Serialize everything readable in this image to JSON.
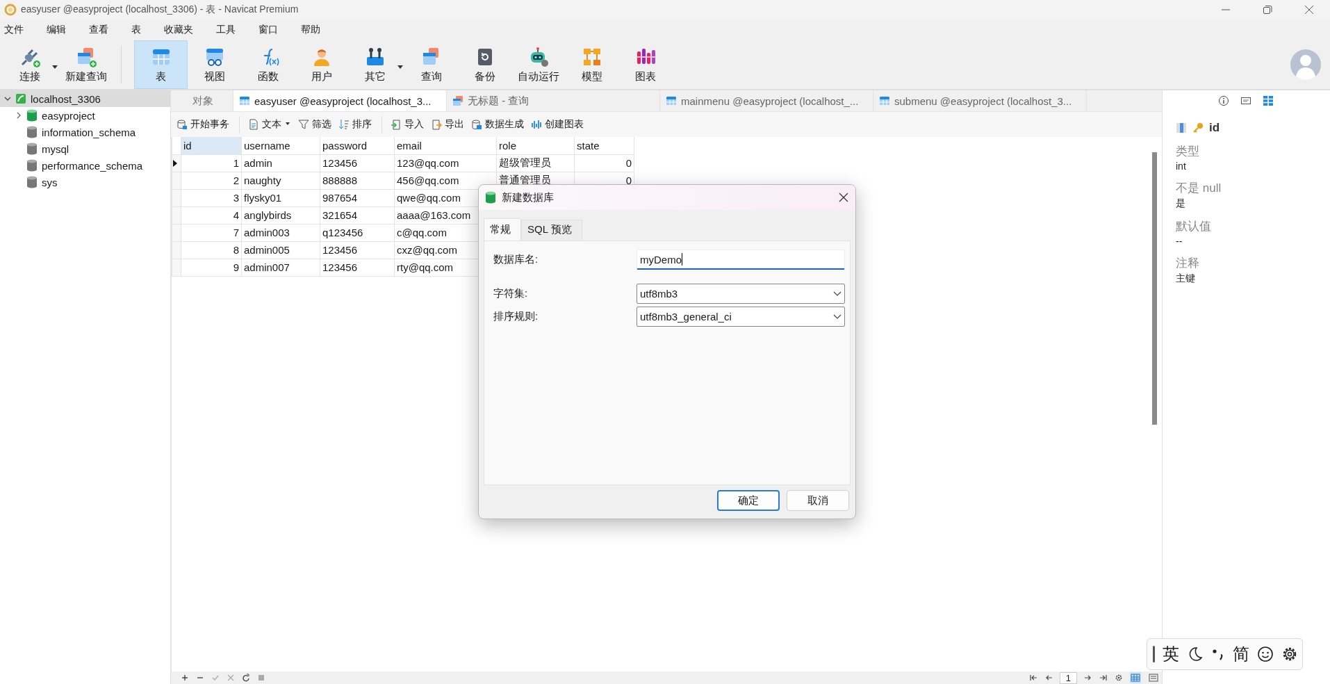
{
  "window": {
    "title": "easyuser @easyproject (localhost_3306) - 表 - Navicat Premium"
  },
  "menu": [
    "文件",
    "编辑",
    "查看",
    "表",
    "收藏夹",
    "工具",
    "窗口",
    "帮助"
  ],
  "toolbar": [
    {
      "label": "连接",
      "selected": false,
      "has_menu": true
    },
    {
      "label": "新建查询",
      "selected": false,
      "has_menu": false
    },
    {
      "label": "表",
      "selected": true,
      "has_menu": false
    },
    {
      "label": "视图",
      "selected": false,
      "has_menu": false
    },
    {
      "label": "函数",
      "selected": false,
      "has_menu": false
    },
    {
      "label": "用户",
      "selected": false,
      "has_menu": false
    },
    {
      "label": "其它",
      "selected": false,
      "has_menu": true
    },
    {
      "label": "查询",
      "selected": false,
      "has_menu": false
    },
    {
      "label": "备份",
      "selected": false,
      "has_menu": false
    },
    {
      "label": "自动运行",
      "selected": false,
      "has_menu": false
    },
    {
      "label": "模型",
      "selected": false,
      "has_menu": false
    },
    {
      "label": "图表",
      "selected": false,
      "has_menu": false
    }
  ],
  "sidebar": {
    "items": [
      {
        "label": "localhost_3306",
        "selected": true,
        "expanded": true,
        "children": [
          {
            "label": "easyproject",
            "selected": false,
            "opened": true
          },
          {
            "label": "information_schema",
            "selected": false,
            "opened": false
          },
          {
            "label": "mysql",
            "selected": false,
            "opened": false
          },
          {
            "label": "performance_schema",
            "selected": false,
            "opened": false
          },
          {
            "label": "sys",
            "selected": false,
            "opened": false
          }
        ]
      }
    ]
  },
  "tabs": [
    {
      "label": "对象",
      "kind": "plain",
      "selected": false
    },
    {
      "label": "easyuser @easyproject (localhost_3...",
      "kind": "table",
      "selected": true
    },
    {
      "label": "无标题 - 查询",
      "kind": "query",
      "selected": false
    },
    {
      "label": "mainmenu @easyproject (localhost_...",
      "kind": "table",
      "selected": false
    },
    {
      "label": "submenu @easyproject (localhost_3...",
      "kind": "table",
      "selected": false
    }
  ],
  "data_toolbar": [
    [
      {
        "label": "开始事务",
        "kind": "transaction"
      }
    ],
    [
      {
        "label": "文本",
        "kind": "text"
      },
      {
        "label": "筛选",
        "kind": "filter"
      },
      {
        "label": "排序",
        "kind": "sort"
      }
    ],
    [
      {
        "label": "导入",
        "kind": "import"
      },
      {
        "label": "导出",
        "kind": "export"
      },
      {
        "label": "数据生成",
        "kind": "generate"
      },
      {
        "label": "创建图表",
        "kind": "chart"
      }
    ]
  ],
  "table": {
    "columns": [
      "id",
      "username",
      "password",
      "email",
      "role",
      "state"
    ],
    "rows": [
      {
        "selected": true,
        "cells": [
          "1",
          "admin",
          "123456",
          "123@qq.com",
          "超级管理员",
          "0"
        ]
      },
      {
        "selected": false,
        "cells": [
          "2",
          "naughty",
          "888888",
          "456@qq.com",
          "普通管理员",
          "0"
        ]
      },
      {
        "selected": false,
        "cells": [
          "3",
          "flysky01",
          "987654",
          "qwe@qq.com"
        ]
      },
      {
        "selected": false,
        "cells": [
          "4",
          "anglybirds",
          "321654",
          "aaaa@163.com"
        ]
      },
      {
        "selected": false,
        "cells": [
          "7",
          "admin003",
          "q123456",
          "c@qq.com"
        ]
      },
      {
        "selected": false,
        "cells": [
          "8",
          "admin005",
          "123456",
          "cxz@qq.com"
        ]
      },
      {
        "selected": false,
        "cells": [
          "9",
          "admin007",
          "123456",
          "rty@qq.com"
        ]
      }
    ]
  },
  "properties": {
    "views": [
      {
        "kind": "info",
        "selected": false
      },
      {
        "kind": "ddl",
        "selected": false
      },
      {
        "kind": "fields",
        "selected": true
      }
    ],
    "field": "id",
    "items": [
      {
        "label": "类型",
        "value": "int"
      },
      {
        "label": "不是 null",
        "value": "是"
      },
      {
        "label": "默认值",
        "value": "--"
      },
      {
        "label": "注释",
        "value": "主键"
      }
    ]
  },
  "dialog": {
    "title": "新建数据库",
    "tabs": [
      {
        "label": "常规",
        "selected": true
      },
      {
        "label": "SQL 预览",
        "selected": false
      }
    ],
    "fields": [
      {
        "label": "数据库名:",
        "kind": "text",
        "value": "myDemo",
        "focused": true
      },
      {
        "label": "字符集:",
        "kind": "select",
        "value": "utf8mb3",
        "focused": false
      },
      {
        "label": "排序规则:",
        "kind": "select",
        "value": "utf8mb3_general_ci",
        "focused": false
      }
    ],
    "buttons": [
      {
        "label": "确定",
        "default": true
      },
      {
        "label": "取消",
        "default": false
      }
    ]
  },
  "status_bar": {
    "page": "1",
    "views": [
      {
        "kind": "grid",
        "selected": true
      },
      {
        "kind": "form",
        "selected": false
      }
    ]
  },
  "ime": {
    "mode": "英",
    "script": "简"
  }
}
